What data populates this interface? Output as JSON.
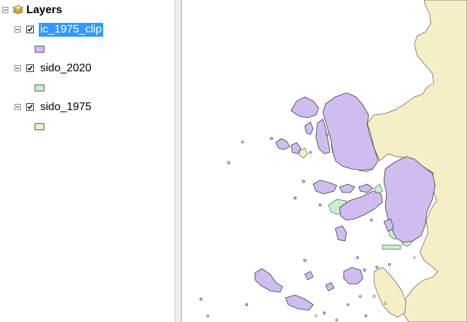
{
  "toc": {
    "root_label": "Layers",
    "layers": [
      {
        "name": "ic_1975_clip",
        "checked": true,
        "selected": true,
        "swatch_color": "#d0bdf0"
      },
      {
        "name": "sido_2020",
        "checked": true,
        "selected": false,
        "swatch_color": "#c8f0cf"
      },
      {
        "name": "sido_1975",
        "checked": true,
        "selected": false,
        "swatch_color": "#f5eec6"
      }
    ]
  },
  "colors": {
    "selection": "#3399ff",
    "land_1975": "#f5eec6",
    "land_2020": "#c8f0cf",
    "clip_1975": "#d0bdf0"
  }
}
